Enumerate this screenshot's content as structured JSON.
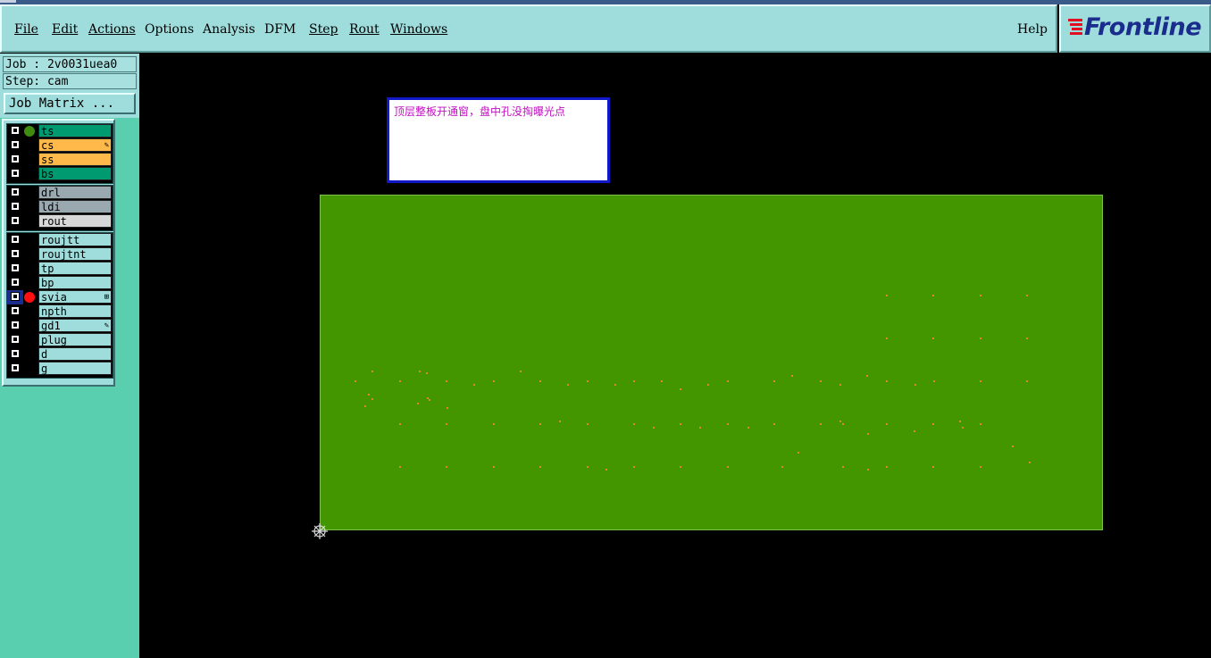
{
  "menubar": {
    "items": [
      {
        "label": "File",
        "underline": true
      },
      {
        "label": "Edit",
        "underline": true
      },
      {
        "label": "Actions",
        "underline": true
      },
      {
        "label": "Options",
        "underline": false
      },
      {
        "label": "Analysis",
        "underline": false
      },
      {
        "label": "DFM",
        "underline": false
      },
      {
        "label": "Step",
        "underline": true
      },
      {
        "label": "Rout",
        "underline": true
      },
      {
        "label": "Windows",
        "underline": true
      }
    ],
    "help": "Help",
    "brand": "Frontline"
  },
  "job_info": {
    "job": "Job : 2v0031uea0",
    "step": "Step: cam",
    "job_matrix_button": "Job Matrix ..."
  },
  "layer_groups": [
    [
      {
        "name": "ts",
        "bg": "#009a70",
        "dot": "#3f8c10",
        "mark": "",
        "selected": false
      },
      {
        "name": "cs",
        "bg": "#ffb84a",
        "dot": "",
        "mark": "✎",
        "selected": false
      },
      {
        "name": "ss",
        "bg": "#ffb84a",
        "dot": "",
        "mark": "",
        "selected": false
      },
      {
        "name": "bs",
        "bg": "#009a70",
        "dot": "",
        "mark": "",
        "selected": false
      }
    ],
    [
      {
        "name": "drl",
        "bg": "#9aa8b0",
        "dot": "",
        "mark": "",
        "selected": false
      },
      {
        "name": "ldi",
        "bg": "#9aa8b0",
        "dot": "",
        "mark": "",
        "selected": false
      },
      {
        "name": "rout",
        "bg": "#d8d8d8",
        "dot": "",
        "mark": "",
        "selected": false
      }
    ],
    [
      {
        "name": "roujtt",
        "bg": "#9fdcdc",
        "dot": "",
        "mark": "",
        "selected": false
      },
      {
        "name": "roujtnt",
        "bg": "#9fdcdc",
        "dot": "",
        "mark": "",
        "selected": false
      },
      {
        "name": "tp",
        "bg": "#9fdcdc",
        "dot": "",
        "mark": "",
        "selected": false
      },
      {
        "name": "bp",
        "bg": "#9fdcdc",
        "dot": "",
        "mark": "",
        "selected": false
      },
      {
        "name": "svia",
        "bg": "#9fdcdc",
        "dot": "#ff1010",
        "mark": "⊞",
        "selected": true
      },
      {
        "name": "npth",
        "bg": "#9fdcdc",
        "dot": "",
        "mark": "",
        "selected": false
      },
      {
        "name": "gd1",
        "bg": "#9fdcdc",
        "dot": "",
        "mark": "✎",
        "selected": false
      },
      {
        "name": "plug",
        "bg": "#9fdcdc",
        "dot": "",
        "mark": "",
        "selected": false
      },
      {
        "name": "d",
        "bg": "#9fdcdc",
        "dot": "",
        "mark": "",
        "selected": false
      },
      {
        "name": "g",
        "bg": "#9fdcdc",
        "dot": "",
        "mark": "",
        "selected": false
      }
    ]
  ],
  "canvas": {
    "note": "顶层整板开通窗，盘中孔没掏曝光点",
    "board_color": "#449600",
    "pad_color": "#e08a20"
  }
}
